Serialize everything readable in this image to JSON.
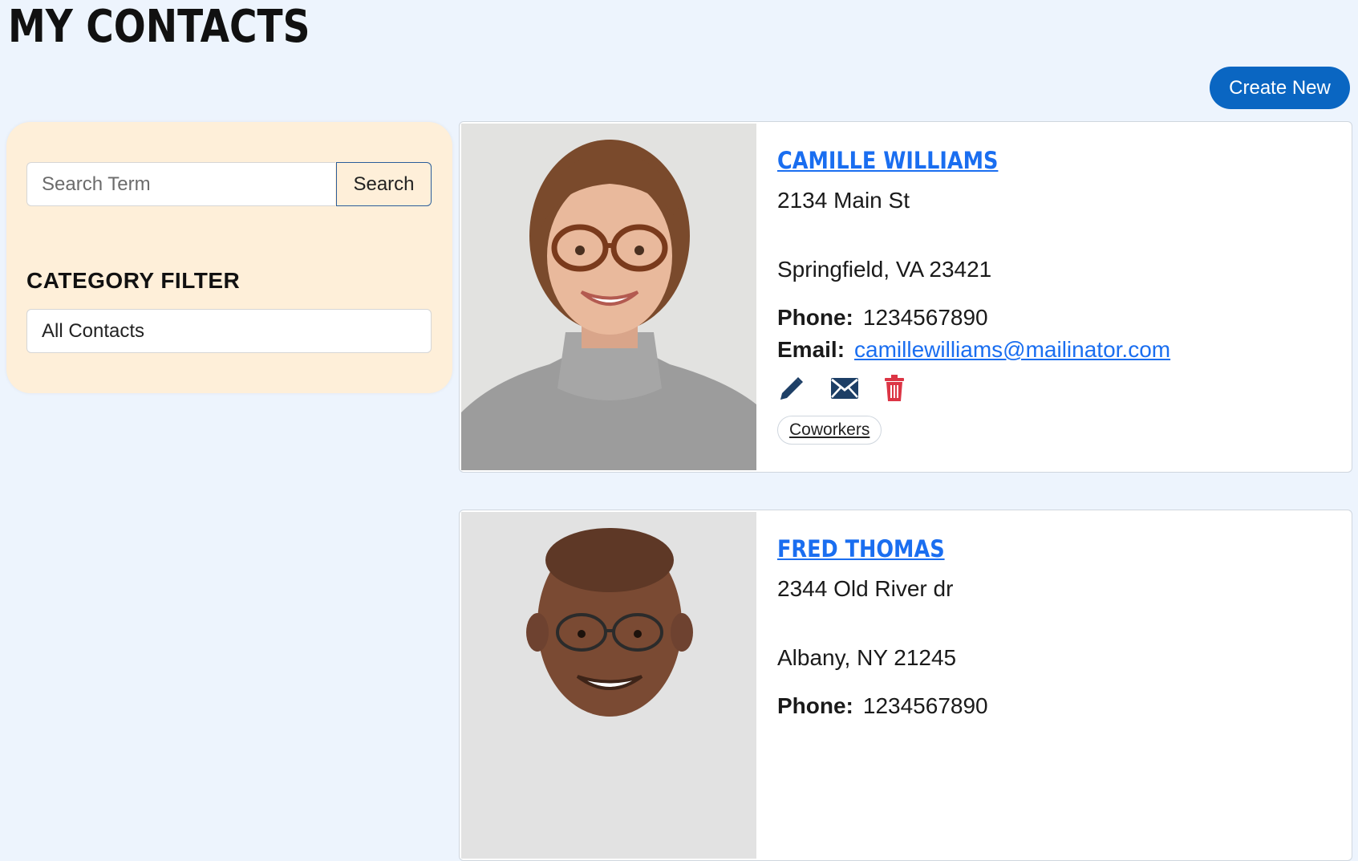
{
  "header": {
    "title": "MY CONTACTS",
    "create_label": "Create New"
  },
  "sidebar": {
    "search_placeholder": "Search Term",
    "search_button": "Search",
    "filter_heading": "CATEGORY FILTER",
    "filter_selected": "All Contacts"
  },
  "contacts": [
    {
      "name": "CAMILLE WILLIAMS",
      "address1": "2134 Main St",
      "address2": "Springfield, VA 23421",
      "phone_label": "Phone:",
      "phone": "1234567890",
      "email_label": "Email:",
      "email": "camillewilliams@mailinator.com",
      "tag": "Coworkers",
      "icons": [
        "edit-icon",
        "envelope-icon",
        "trash-icon"
      ]
    },
    {
      "name": "FRED THOMAS",
      "address1": "2344 Old River dr",
      "address2": "Albany, NY 21245",
      "phone_label": "Phone:",
      "phone": "1234567890"
    }
  ],
  "colors": {
    "page_bg": "#edf4fd",
    "sidebar_bg": "#feefd9",
    "accent": "#0a66c2",
    "link": "#1a6ef0",
    "edit_icon": "#1d3f66",
    "delete_icon": "#dc3545"
  }
}
